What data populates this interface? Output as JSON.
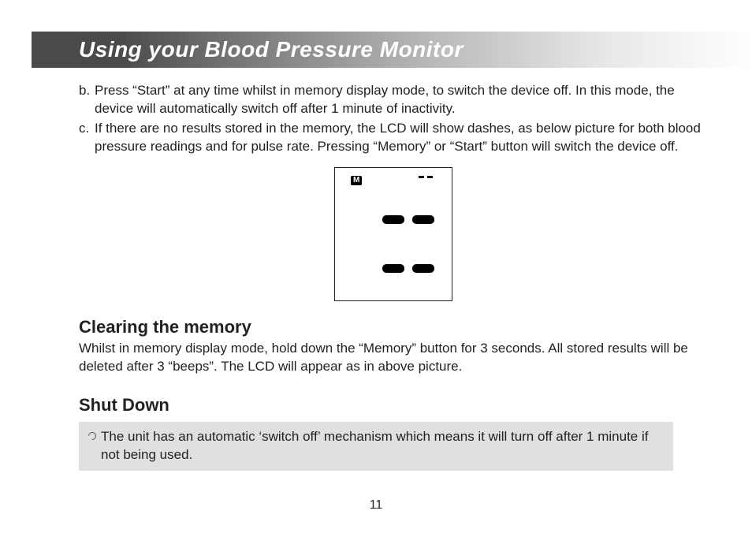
{
  "header": {
    "title": "Using your Blood Pressure Monitor"
  },
  "items": [
    {
      "marker": "b.",
      "text": "Press “Start” at any time whilst in memory display mode, to switch the device off. In this mode, the device will automatically switch off after 1 minute of inactivity."
    },
    {
      "marker": "c.",
      "text": "If there are no results stored in the memory, the LCD will show dashes, as below picture for both blood pressure readings and for pulse rate. Pressing “Memory” or “Start” button will switch the device off."
    }
  ],
  "lcd": {
    "m_label": "M"
  },
  "clearing": {
    "heading": "Clearing the memory",
    "text": "Whilst in memory display mode, hold down the “Memory” button for 3 seconds. All stored results will be deleted after 3 “beeps”. The LCD will appear as in above picture."
  },
  "shutdown": {
    "heading": "Shut Down",
    "text": "The unit has an automatic ‘switch off’ mechanism which means it will turn off after 1 minute if not being used."
  },
  "page": "11"
}
